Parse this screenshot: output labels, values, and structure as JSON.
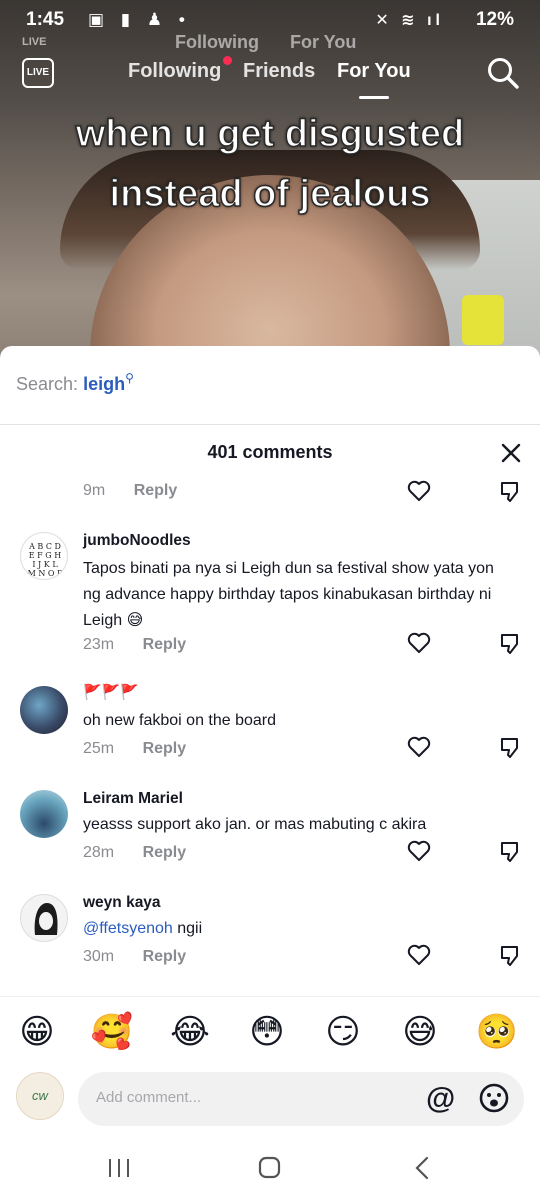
{
  "status_bar": {
    "time": "1:45",
    "battery": "12%"
  },
  "top_nav": {
    "live_label": "LIVE",
    "tabs": [
      {
        "label": "Following"
      },
      {
        "label": "Friends"
      },
      {
        "label": "For You"
      }
    ],
    "ghost_tabs": [
      "Following",
      "For You"
    ]
  },
  "video": {
    "caption_line1": "when u get disgusted",
    "caption_line2": "instead of jealous"
  },
  "search": {
    "prefix": "Search:",
    "keyword": "leigh"
  },
  "sheet": {
    "count_label": "401 comments"
  },
  "partial_comment": {
    "time": "9m",
    "reply_label": "Reply"
  },
  "comments": [
    {
      "username": "jumboNoodles",
      "text": "Tapos binati pa nya si Leigh dun sa festival show yata yon ng advance happy birthday tapos kinabukasan birthday ni Leigh 😅",
      "time": "23m",
      "reply_label": "Reply"
    },
    {
      "username": "🚩🚩🚩",
      "text": "oh new fakboi on the board",
      "time": "25m",
      "reply_label": "Reply"
    },
    {
      "username": "Leiram Mariel",
      "text": "yeasss support ako jan. or mas mabuting c akira",
      "time": "28m",
      "reply_label": "Reply"
    },
    {
      "username": "weyn kaya",
      "mention": "@ffetsyenoh",
      "text": " ngii",
      "time": "30m",
      "reply_label": "Reply"
    }
  ],
  "emoji_bar": [
    "😁",
    "🥰",
    "😂",
    "😳",
    "😏",
    "😅",
    "🥺"
  ],
  "composer": {
    "placeholder": "Add comment...",
    "at_label": "@"
  },
  "icons": {
    "search": "search-icon",
    "close": "close-icon",
    "heart": "heart-icon",
    "dislike": "thumbs-down-icon",
    "emoji": "emoji-icon"
  },
  "colors": {
    "accent_link": "#2b5dbf",
    "live_dot": "#fe2c55",
    "muted_text": "#8a8b91"
  }
}
